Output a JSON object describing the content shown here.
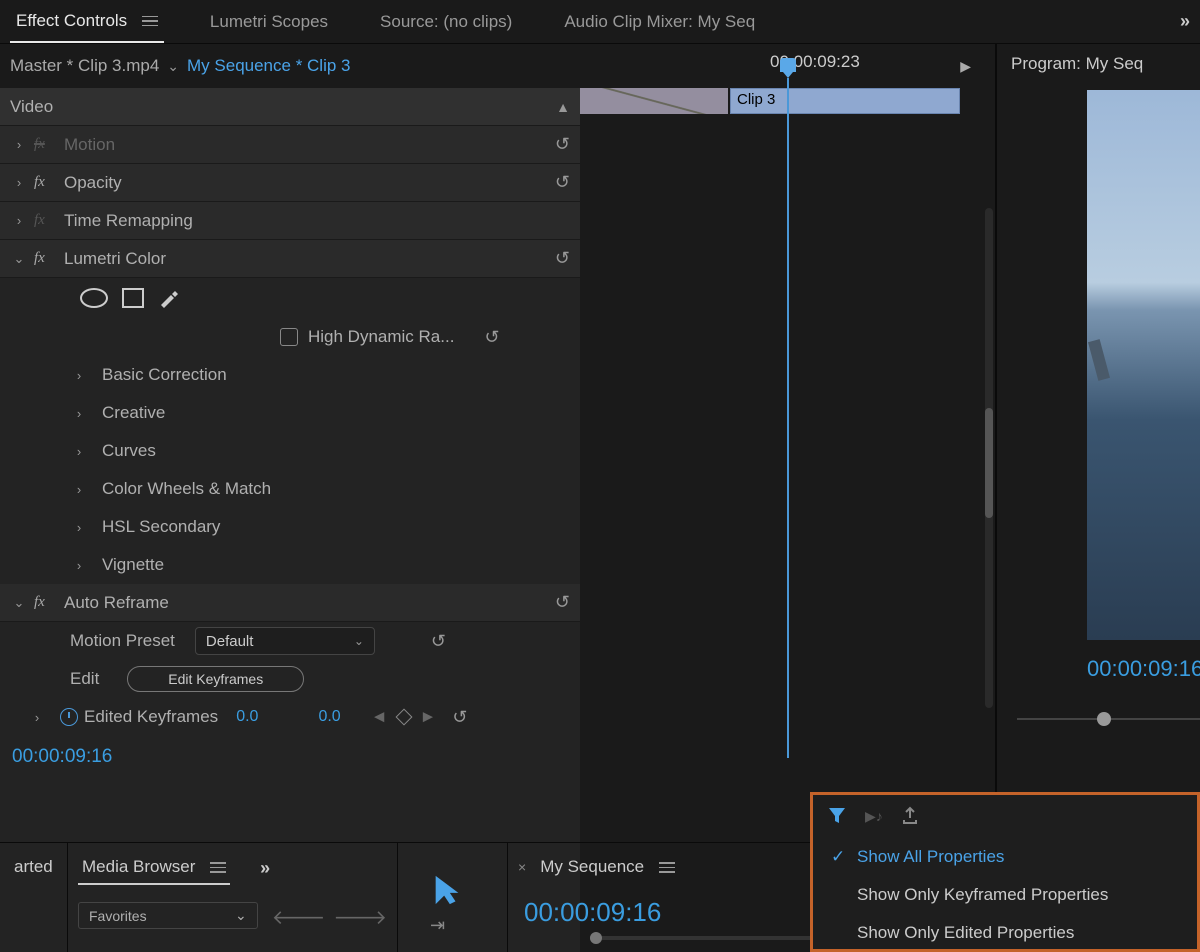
{
  "tabs": {
    "effect_controls": "Effect Controls",
    "lumetri_scopes": "Lumetri Scopes",
    "source": "Source: (no clips)",
    "audio_mixer": "Audio Clip Mixer: My Seq",
    "program": "Program: My Seq"
  },
  "header": {
    "master": "Master * Clip 3.mp4",
    "sequence": "My Sequence * Clip 3"
  },
  "timeline": {
    "playhead_time": "00:00:09:23",
    "clip_label": "Clip 3"
  },
  "video_section": "Video",
  "effects": {
    "motion": "Motion",
    "opacity": "Opacity",
    "time_remapping": "Time Remapping",
    "lumetri": "Lumetri Color",
    "hdr": "High Dynamic Ra...",
    "lumetri_subs": {
      "basic": "Basic Correction",
      "creative": "Creative",
      "curves": "Curves",
      "wheels": "Color Wheels & Match",
      "hsl": "HSL Secondary",
      "vignette": "Vignette"
    },
    "auto_reframe": "Auto Reframe",
    "motion_preset": "Motion Preset",
    "motion_preset_value": "Default",
    "edit": "Edit",
    "edit_keyframes_btn": "Edit Keyframes",
    "edited_keyframes": "Edited Keyframes",
    "kf_val1": "0.0",
    "kf_val2": "0.0"
  },
  "current_time": "00:00:09:16",
  "program_time": "00:00:09:16",
  "bottom": {
    "started": "arted",
    "media_browser": "Media Browser",
    "favorites": "Favorites",
    "my_sequence": "My Sequence",
    "seq_time": "00:00:09:16"
  },
  "filter_menu": {
    "show_all": "Show All Properties",
    "show_keyframed": "Show Only Keyframed Properties",
    "show_edited": "Show Only Edited Properties"
  }
}
